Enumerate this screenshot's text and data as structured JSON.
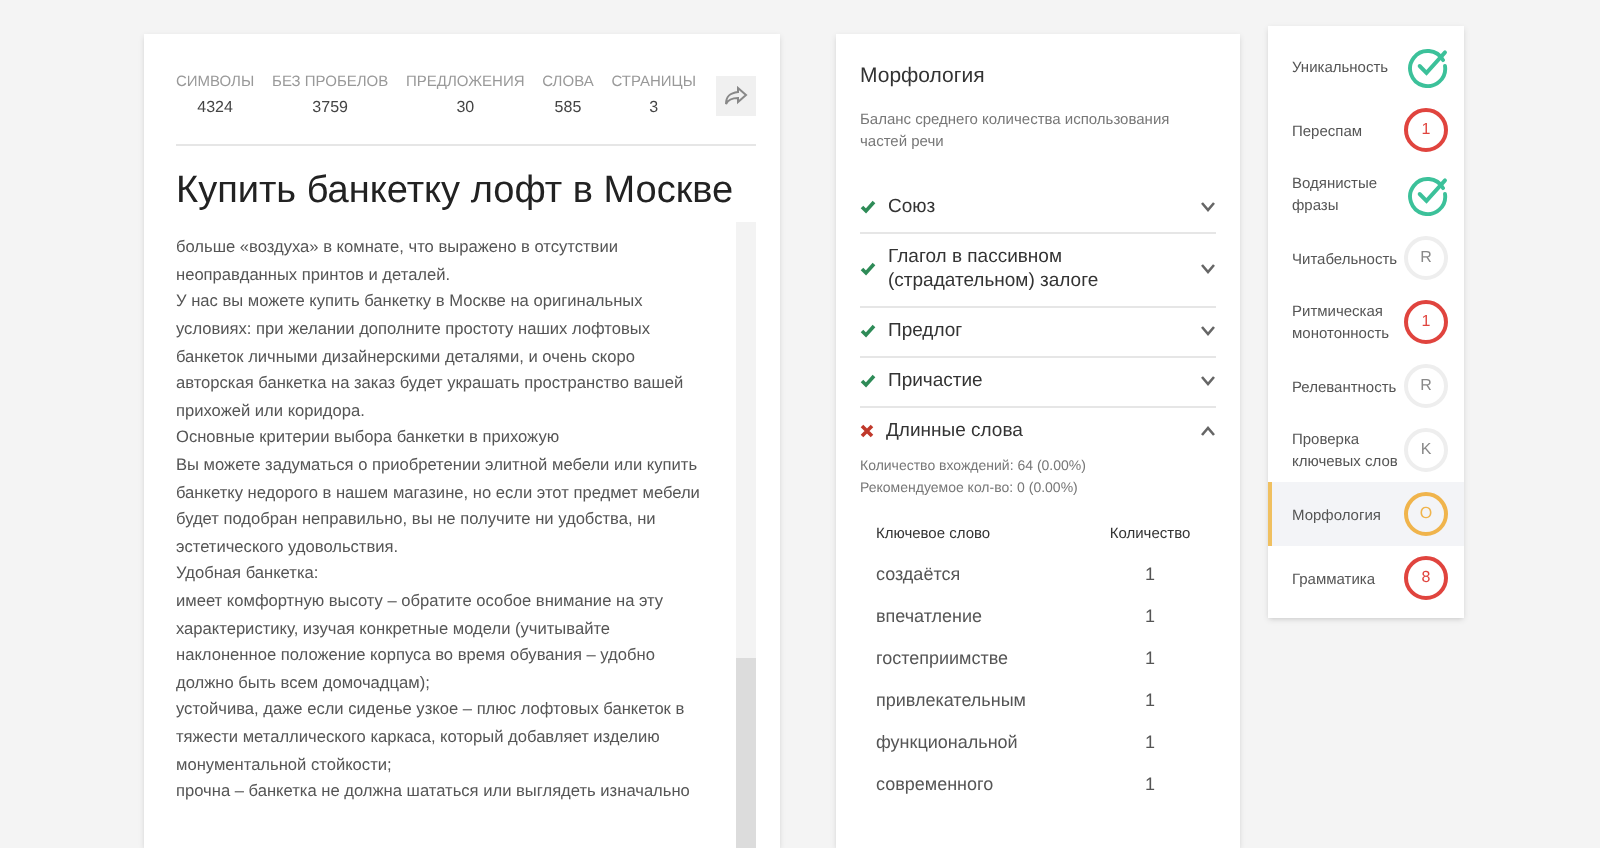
{
  "stats": [
    {
      "label": "СИМВОЛЫ",
      "value": "4324"
    },
    {
      "label": "БЕЗ ПРОБЕЛОВ",
      "value": "3759"
    },
    {
      "label": "ПРЕДЛОЖЕНИЯ",
      "value": "30"
    },
    {
      "label": "СЛОВА",
      "value": "585"
    },
    {
      "label": "СТРАНИЦЫ",
      "value": "3"
    }
  ],
  "title": "Купить банкетку лофт в Москве",
  "text_lines": [
    "больше «воздуха» в комнате, что выражено в отсутствии",
    "неоправданных принтов и деталей.",
    "У нас вы можете купить банкетку в Москве на оригинальных",
    "условиях: при желании дополните простоту наших лофтовых",
    "банкеток личными дизайнерскими деталями, и очень скоро",
    "авторская банкетка на заказ будет украшать пространство вашей",
    "прихожей или коридора.",
    "Основные критерии выбора банкетки в прихожую",
    "Вы можете задуматься о приобретении элитной мебели или купить",
    "банкетку недорого в нашем магазине, но если этот предмет мебели",
    "будет подобран неправильно, вы не получите ни удобства, ни",
    "эстетического удовольствия.",
    "Удобная банкетка:",
    "имеет комфортную высоту – обратите особое внимание на эту",
    "характеристику, изучая конкретные модели (учитывайте",
    "наклоненное положение корпуса во время обувания – удобно",
    "должно быть всем домочадцам);",
    "устойчива, даже если сиденье узкое – плюс лофтовых банкеток в",
    "тяжести металлического каркаса, который добавляет изделию",
    "монументальной стойкости;",
    "прочна – банкетка не должна шататься или выглядеть изначально"
  ],
  "panel": {
    "title": "Морфология",
    "description": "Баланс среднего количества использования частей речи",
    "items": [
      {
        "label": "Союз",
        "passed": true,
        "expanded": false
      },
      {
        "label": "Глагол в пассивном (страдательном) залоге",
        "passed": true,
        "expanded": false
      },
      {
        "label": "Предлог",
        "passed": true,
        "expanded": false
      },
      {
        "label": "Причастие",
        "passed": true,
        "expanded": false
      },
      {
        "label": "Длинные слова",
        "passed": false,
        "expanded": true,
        "details": [
          "Количество вхождений: 64 (0.00%)",
          "Рекомендуемое кол-во: 0 (0.00%)"
        ],
        "table": {
          "columns": [
            "Ключевое слово",
            "Количество"
          ],
          "rows": [
            [
              "создаётся",
              "1"
            ],
            [
              "впечатление",
              "1"
            ],
            [
              "гостеприимстве",
              "1"
            ],
            [
              "привлекательным",
              "1"
            ],
            [
              "функциональной",
              "1"
            ],
            [
              "современного",
              "1"
            ]
          ]
        }
      }
    ]
  },
  "nav": [
    {
      "label": "Уникальность",
      "selected": false,
      "badge": {
        "kind": "check",
        "color": "#3cc19a"
      }
    },
    {
      "label": "Переспам",
      "selected": false,
      "badge": {
        "kind": "text",
        "text": "1",
        "color": "#e0443e"
      }
    },
    {
      "label": "Водянистые фразы",
      "selected": false,
      "badge": {
        "kind": "check",
        "color": "#3cc19a"
      }
    },
    {
      "label": "Читабельность",
      "selected": false,
      "badge": {
        "kind": "text",
        "text": "R",
        "color": "#eeeeee"
      }
    },
    {
      "label": "Ритмическая монотонность",
      "selected": false,
      "badge": {
        "kind": "text",
        "text": "1",
        "color": "#e0443e"
      }
    },
    {
      "label": "Релевантность",
      "selected": false,
      "badge": {
        "kind": "text",
        "text": "R",
        "color": "#eeeeee"
      }
    },
    {
      "label": "Проверка ключевых слов",
      "selected": false,
      "badge": {
        "kind": "text",
        "text": "K",
        "color": "#eeeeee"
      }
    },
    {
      "label": "Морфология",
      "selected": true,
      "badge": {
        "kind": "text",
        "text": "O",
        "color": "#f0b44c"
      }
    },
    {
      "label": "Грамматика",
      "selected": false,
      "badge": {
        "kind": "text",
        "text": "8",
        "color": "#e0443e"
      }
    }
  ]
}
